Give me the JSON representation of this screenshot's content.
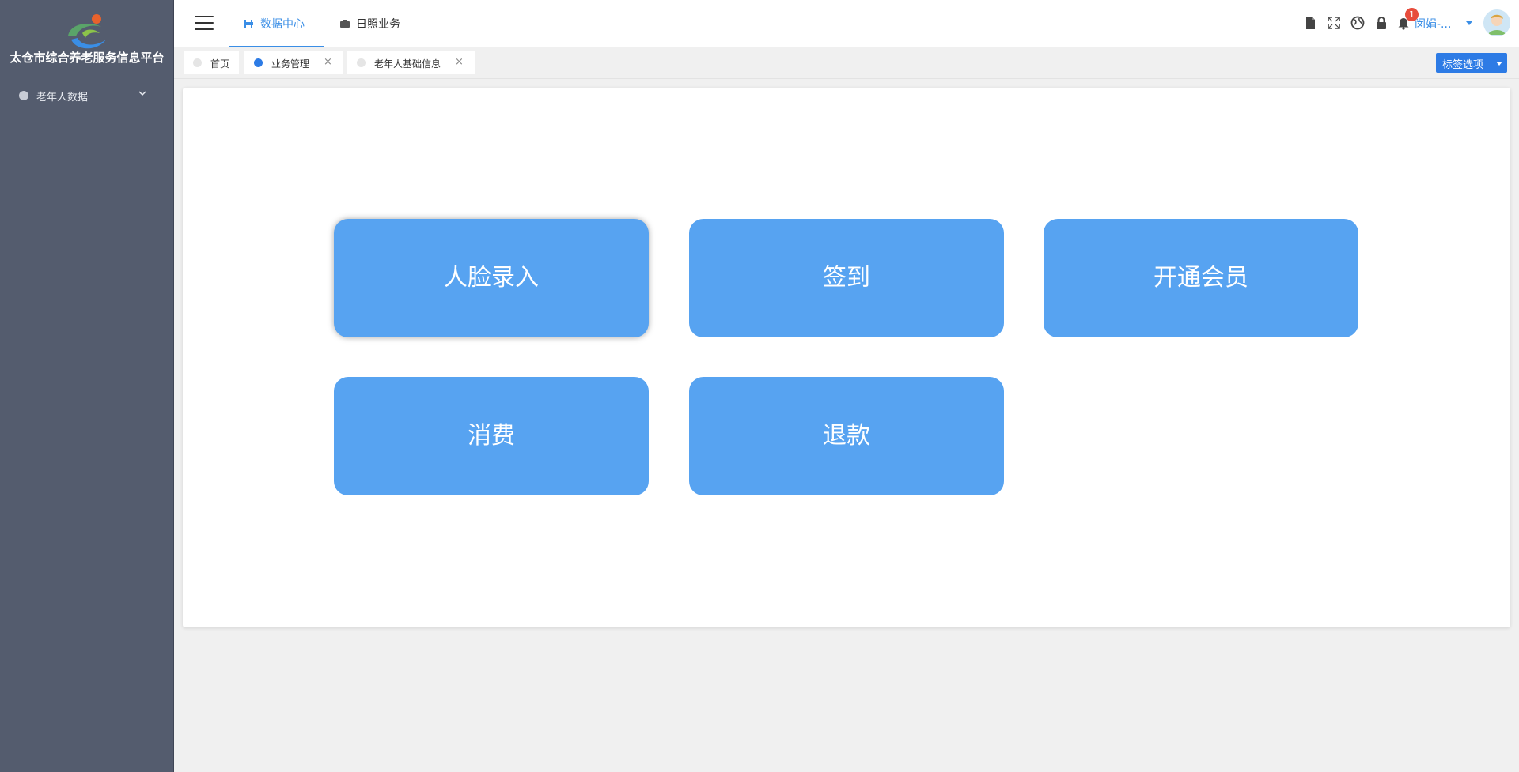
{
  "sidebar": {
    "platform_name": "太仓市综合养老服务信息平台",
    "menu": [
      {
        "label": "老年人数据",
        "icon": "elder-data-icon",
        "expandable": true
      }
    ]
  },
  "header": {
    "nav_tabs": [
      {
        "label": "数据中心",
        "icon": "data-center-icon",
        "active": true
      },
      {
        "label": "日照业务",
        "icon": "briefcase-icon",
        "active": false
      }
    ],
    "tools": [
      "file-icon",
      "fullscreen-icon",
      "globe-icon",
      "lock-icon",
      "bell-icon"
    ],
    "notification_count": "1",
    "user_name": "闵娟-...",
    "accent_color": "#3a8ee6"
  },
  "tabs": {
    "items": [
      {
        "label": "首页",
        "active": false,
        "closable": false
      },
      {
        "label": "业务管理",
        "active": true,
        "closable": true
      },
      {
        "label": "老年人基础信息",
        "active": false,
        "closable": true
      }
    ],
    "close_glyph": "×",
    "options_label": "标签选项"
  },
  "actions": {
    "buttons": [
      {
        "label": "人脸录入"
      },
      {
        "label": "签到"
      },
      {
        "label": "开通会员"
      },
      {
        "label": "消费"
      },
      {
        "label": "退款"
      }
    ],
    "button_color": "#57a3f1"
  }
}
